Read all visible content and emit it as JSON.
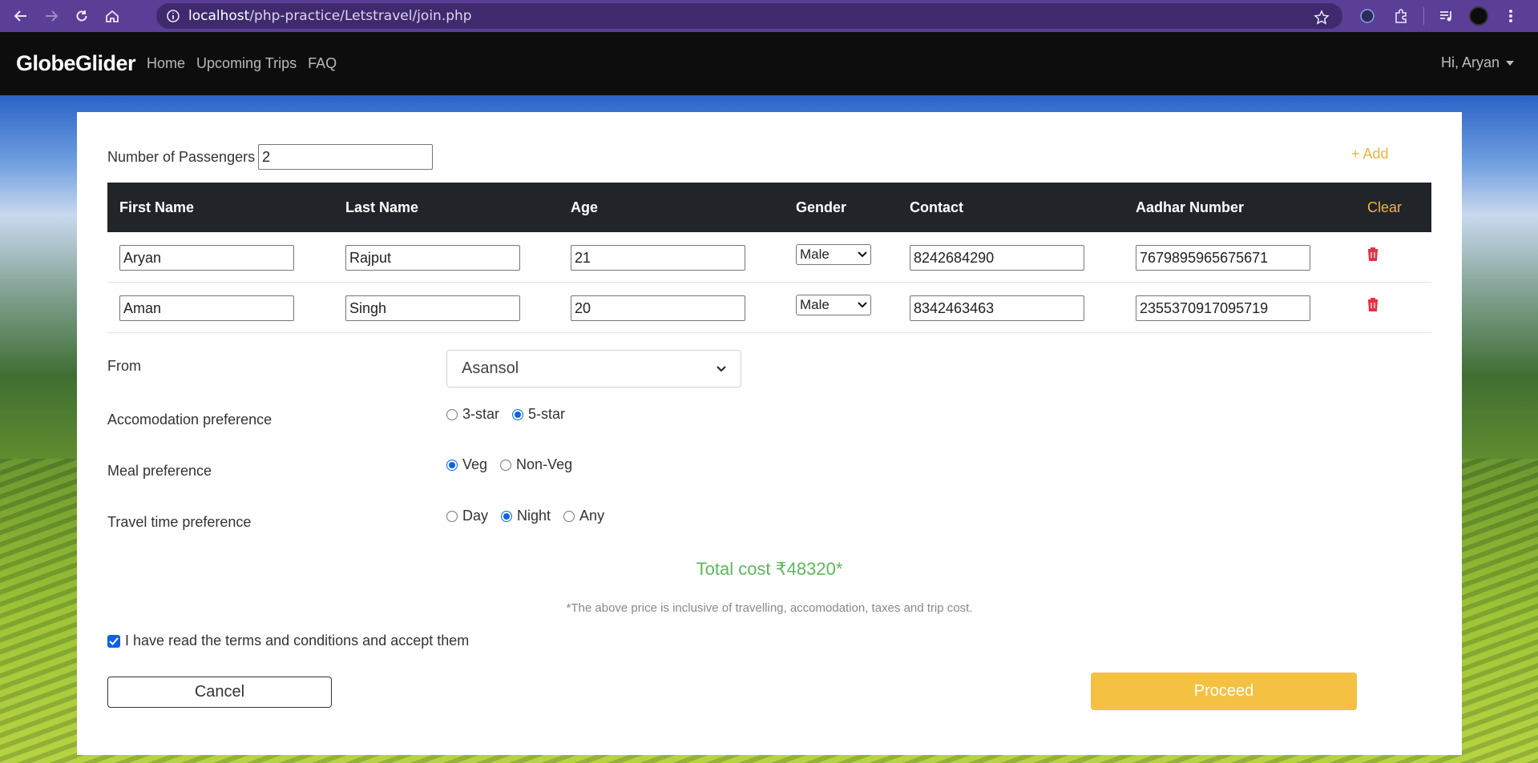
{
  "browser": {
    "url_host": "localhost",
    "url_path": "/php-practice/Letstravel/join.php"
  },
  "navbar": {
    "brand": "GlobeGlider",
    "links": [
      "Home",
      "Upcoming Trips",
      "FAQ"
    ],
    "user_menu": "Hi, Aryan"
  },
  "form": {
    "passengers_label": "Number of Passengers",
    "passengers_value": "2",
    "add_label": "+ Add",
    "columns": [
      "First Name",
      "Last Name",
      "Age",
      "Gender",
      "Contact",
      "Aadhar Number"
    ],
    "clear_label": "Clear",
    "rows": [
      {
        "first_name": "Aryan",
        "last_name": "Rajput",
        "age": "21",
        "gender": "Male",
        "contact": "8242684290",
        "aadhar": "7679895965675671"
      },
      {
        "first_name": "Aman",
        "last_name": "Singh",
        "age": "20",
        "gender": "Male",
        "contact": "8342463463",
        "aadhar": "2355370917095719"
      }
    ],
    "from_label": "From",
    "from_value": "Asansol",
    "accommodation_label": "Accomodation preference",
    "accommodation_options": [
      "3-star",
      "5-star"
    ],
    "accommodation_selected": "5-star",
    "meal_label": "Meal preference",
    "meal_options": [
      "Veg",
      "Non-Veg"
    ],
    "meal_selected": "Veg",
    "time_label": "Travel time preference",
    "time_options": [
      "Day",
      "Night",
      "Any"
    ],
    "time_selected": "Night",
    "total_cost": "Total cost ₹48320*",
    "price_note": "*The above price is inclusive of travelling, accomodation, taxes and trip cost.",
    "terms_label": "I have read the terms and conditions and accept them",
    "terms_checked": true,
    "cancel_label": "Cancel",
    "proceed_label": "Proceed"
  },
  "colors": {
    "accent_gold": "#f0b539",
    "total_green": "#5cb85c",
    "delete_red": "#dc3545",
    "browser_purple": "#5b3e96"
  }
}
